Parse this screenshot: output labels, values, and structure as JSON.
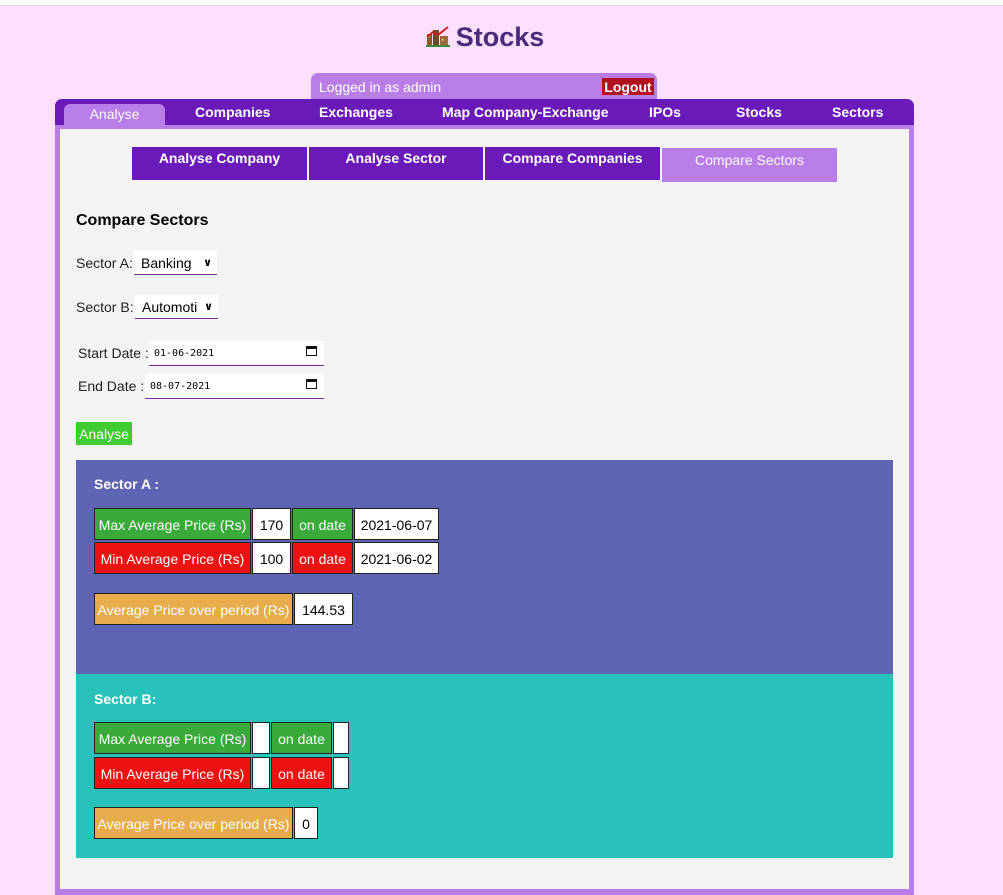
{
  "header": {
    "title": "Stocks",
    "logo_icon": "chart-building-icon"
  },
  "login": {
    "text": "Logged in as admin",
    "logout_label": "Logout"
  },
  "nav": {
    "active": "Analyse",
    "items": [
      "Companies",
      "Exchanges",
      "Map Company-Exchange",
      "IPOs",
      "Stocks",
      "Sectors"
    ]
  },
  "subtabs": [
    "Analyse Company",
    "Analyse Sector",
    "Compare Companies",
    "Compare Sectors"
  ],
  "form": {
    "heading": "Compare Sectors",
    "sector_a_label": "Sector A:",
    "sector_a_value": "Banking",
    "sector_b_label": "Sector B:",
    "sector_b_value": "Automoti",
    "start_label": "Start Date :",
    "start_value": "01-06-2021",
    "end_label": "End Date :",
    "end_value": "08-07-2021",
    "analyse_label": "Analyse"
  },
  "sector_a": {
    "heading": "Sector A :",
    "max_label": "Max Average Price (Rs)",
    "max_value": "170",
    "max_on": "on date",
    "max_date": "2021-06-07",
    "min_label": "Min Average Price (Rs)",
    "min_value": "100",
    "min_on": "on date",
    "min_date": "2021-06-02",
    "avg_label": "Average Price over period (Rs)",
    "avg_value": "144.53"
  },
  "sector_b": {
    "heading": "Sector B:",
    "max_label": "Max Average Price (Rs)",
    "max_value": "",
    "max_on": "on date",
    "max_date": "",
    "min_label": "Min Average Price (Rs)",
    "min_value": "",
    "min_on": "on date",
    "min_date": "",
    "avg_label": "Average Price over period (Rs)",
    "avg_value": "0"
  },
  "colors": {
    "nav": "#6a1ab8",
    "active": "#b97de8",
    "sector_a_bg": "#5e64b4",
    "sector_b_bg": "#28c2bb",
    "max_cell": "#3aaa3a",
    "min_cell": "#ee1111",
    "avg_cell": "#e7ad4c",
    "analyse_btn": "#3ecc30"
  }
}
